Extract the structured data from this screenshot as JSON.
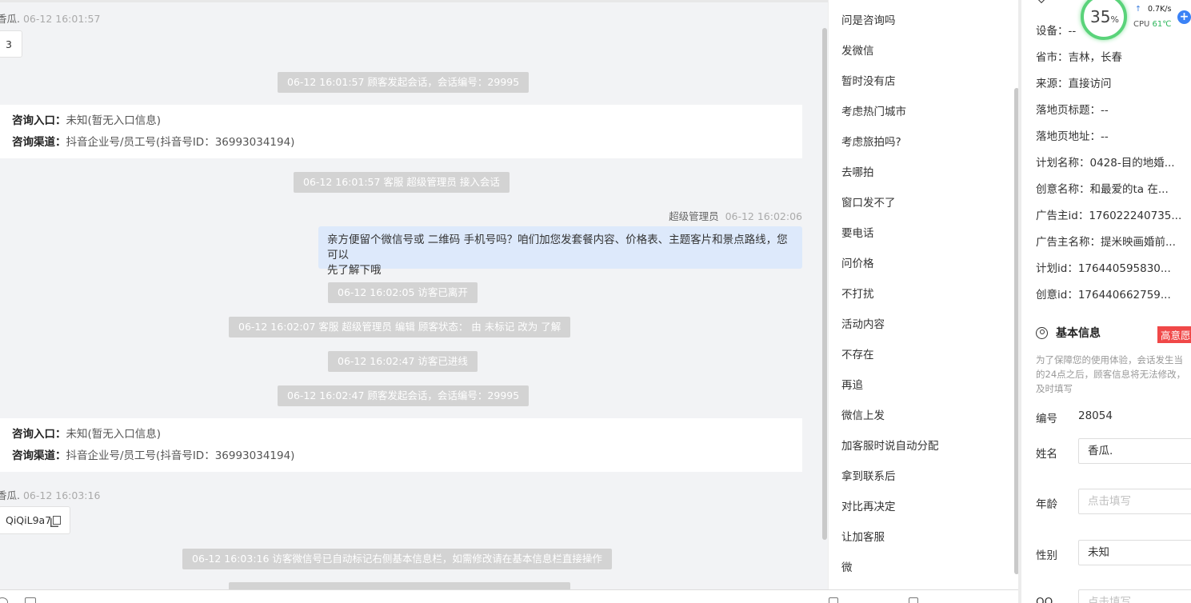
{
  "chat": {
    "msg1": {
      "sender": "香瓜.",
      "time": "06-12 16:01:57",
      "text": "3"
    },
    "sys1": "06-12 16:01:57 顾客发起会话，会话编号：29995",
    "card1": {
      "entry_label": "咨询入口：",
      "entry_value": "未知(暂无入口信息)",
      "channel_label": "咨询渠道：",
      "channel_value": "抖音企业号/员工号(抖音号ID：36993034194)"
    },
    "sys2": "06-12 16:01:57 客服 超级管理员 接入会话",
    "msg2": {
      "sender": "超级管理员",
      "time": "06-12 16:02:06",
      "text_line1": "亲方便留个微信号或 二维码 手机号吗？咱们加您发套餐内容、价格表、主题客片和景点路线，您可以",
      "text_line2": "先了解下哦"
    },
    "sys3": "06-12 16:02:05 访客已离开",
    "sys4": "06-12 16:02:07 客服 超级管理员 编辑 顾客状态： 由 未标记 改为 了解",
    "sys5": "06-12 16:02:47 访客已进线",
    "sys6": "06-12 16:02:47 顾客发起会话，会话编号：29995",
    "card2": {
      "entry_label": "咨询入口：",
      "entry_value": "未知(暂无入口信息)",
      "channel_label": "咨询渠道：",
      "channel_value": "抖音企业号/员工号(抖音号ID：36993034194)"
    },
    "msg3": {
      "sender": "香瓜.",
      "time": "06-12 16:03:16",
      "text": "QiQiL9a7"
    },
    "sys7": "06-12 16:03:16 访客微信号已自动标记右侧基本信息栏，如需修改请在基本信息栏直接操作"
  },
  "quick_replies": [
    "问是咨询吗",
    "发微信",
    "暂时没有店",
    "考虑热门城市",
    "考虑旅拍吗?",
    "去哪拍",
    "窗口发不了",
    "要电话",
    "问价格",
    "不打扰",
    "活动内容",
    "不存在",
    "再追",
    "微信上发",
    "加客服时说自动分配",
    "拿到联系后",
    "对比再决定",
    "让加客服",
    "微"
  ],
  "source": {
    "device": "设备：--",
    "province": "省市：吉林，长春",
    "origin": "来源：直接访问",
    "landing_title": "落地页标题：--",
    "landing_url": "落地页地址：--",
    "plan_name": "计划名称：0428-目的地婚...",
    "creative_name": "创意名称：和最爱的ta 在...",
    "advertiser_id": "广告主id：176022240735...",
    "advertiser_name": "广告主名称：提米映画婚前...",
    "plan_id": "计划id：176440595830...",
    "creative_id": "创意id：176440662759..."
  },
  "basic": {
    "title": "基本信息",
    "intent_tag": "高意愿",
    "note_line1": "为了保障您的使用体验，会话发生当",
    "note_line2": "的24点之后，顾客信息将无法修改，",
    "note_line3": "及时填写",
    "id_label": "编号",
    "id_value": "28054",
    "name_label": "姓名",
    "name_value": "香瓜.",
    "age_label": "年龄",
    "age_placeholder": "点击填写",
    "gender_label": "性别",
    "gender_value": "未知",
    "qq_label": "QQ",
    "qq_placeholder": "点击填写"
  },
  "cpu_widget": {
    "percent": "35",
    "percent_unit": "%",
    "net": "0.7K/s",
    "cpu_label": "CPU",
    "temp": "61℃"
  }
}
